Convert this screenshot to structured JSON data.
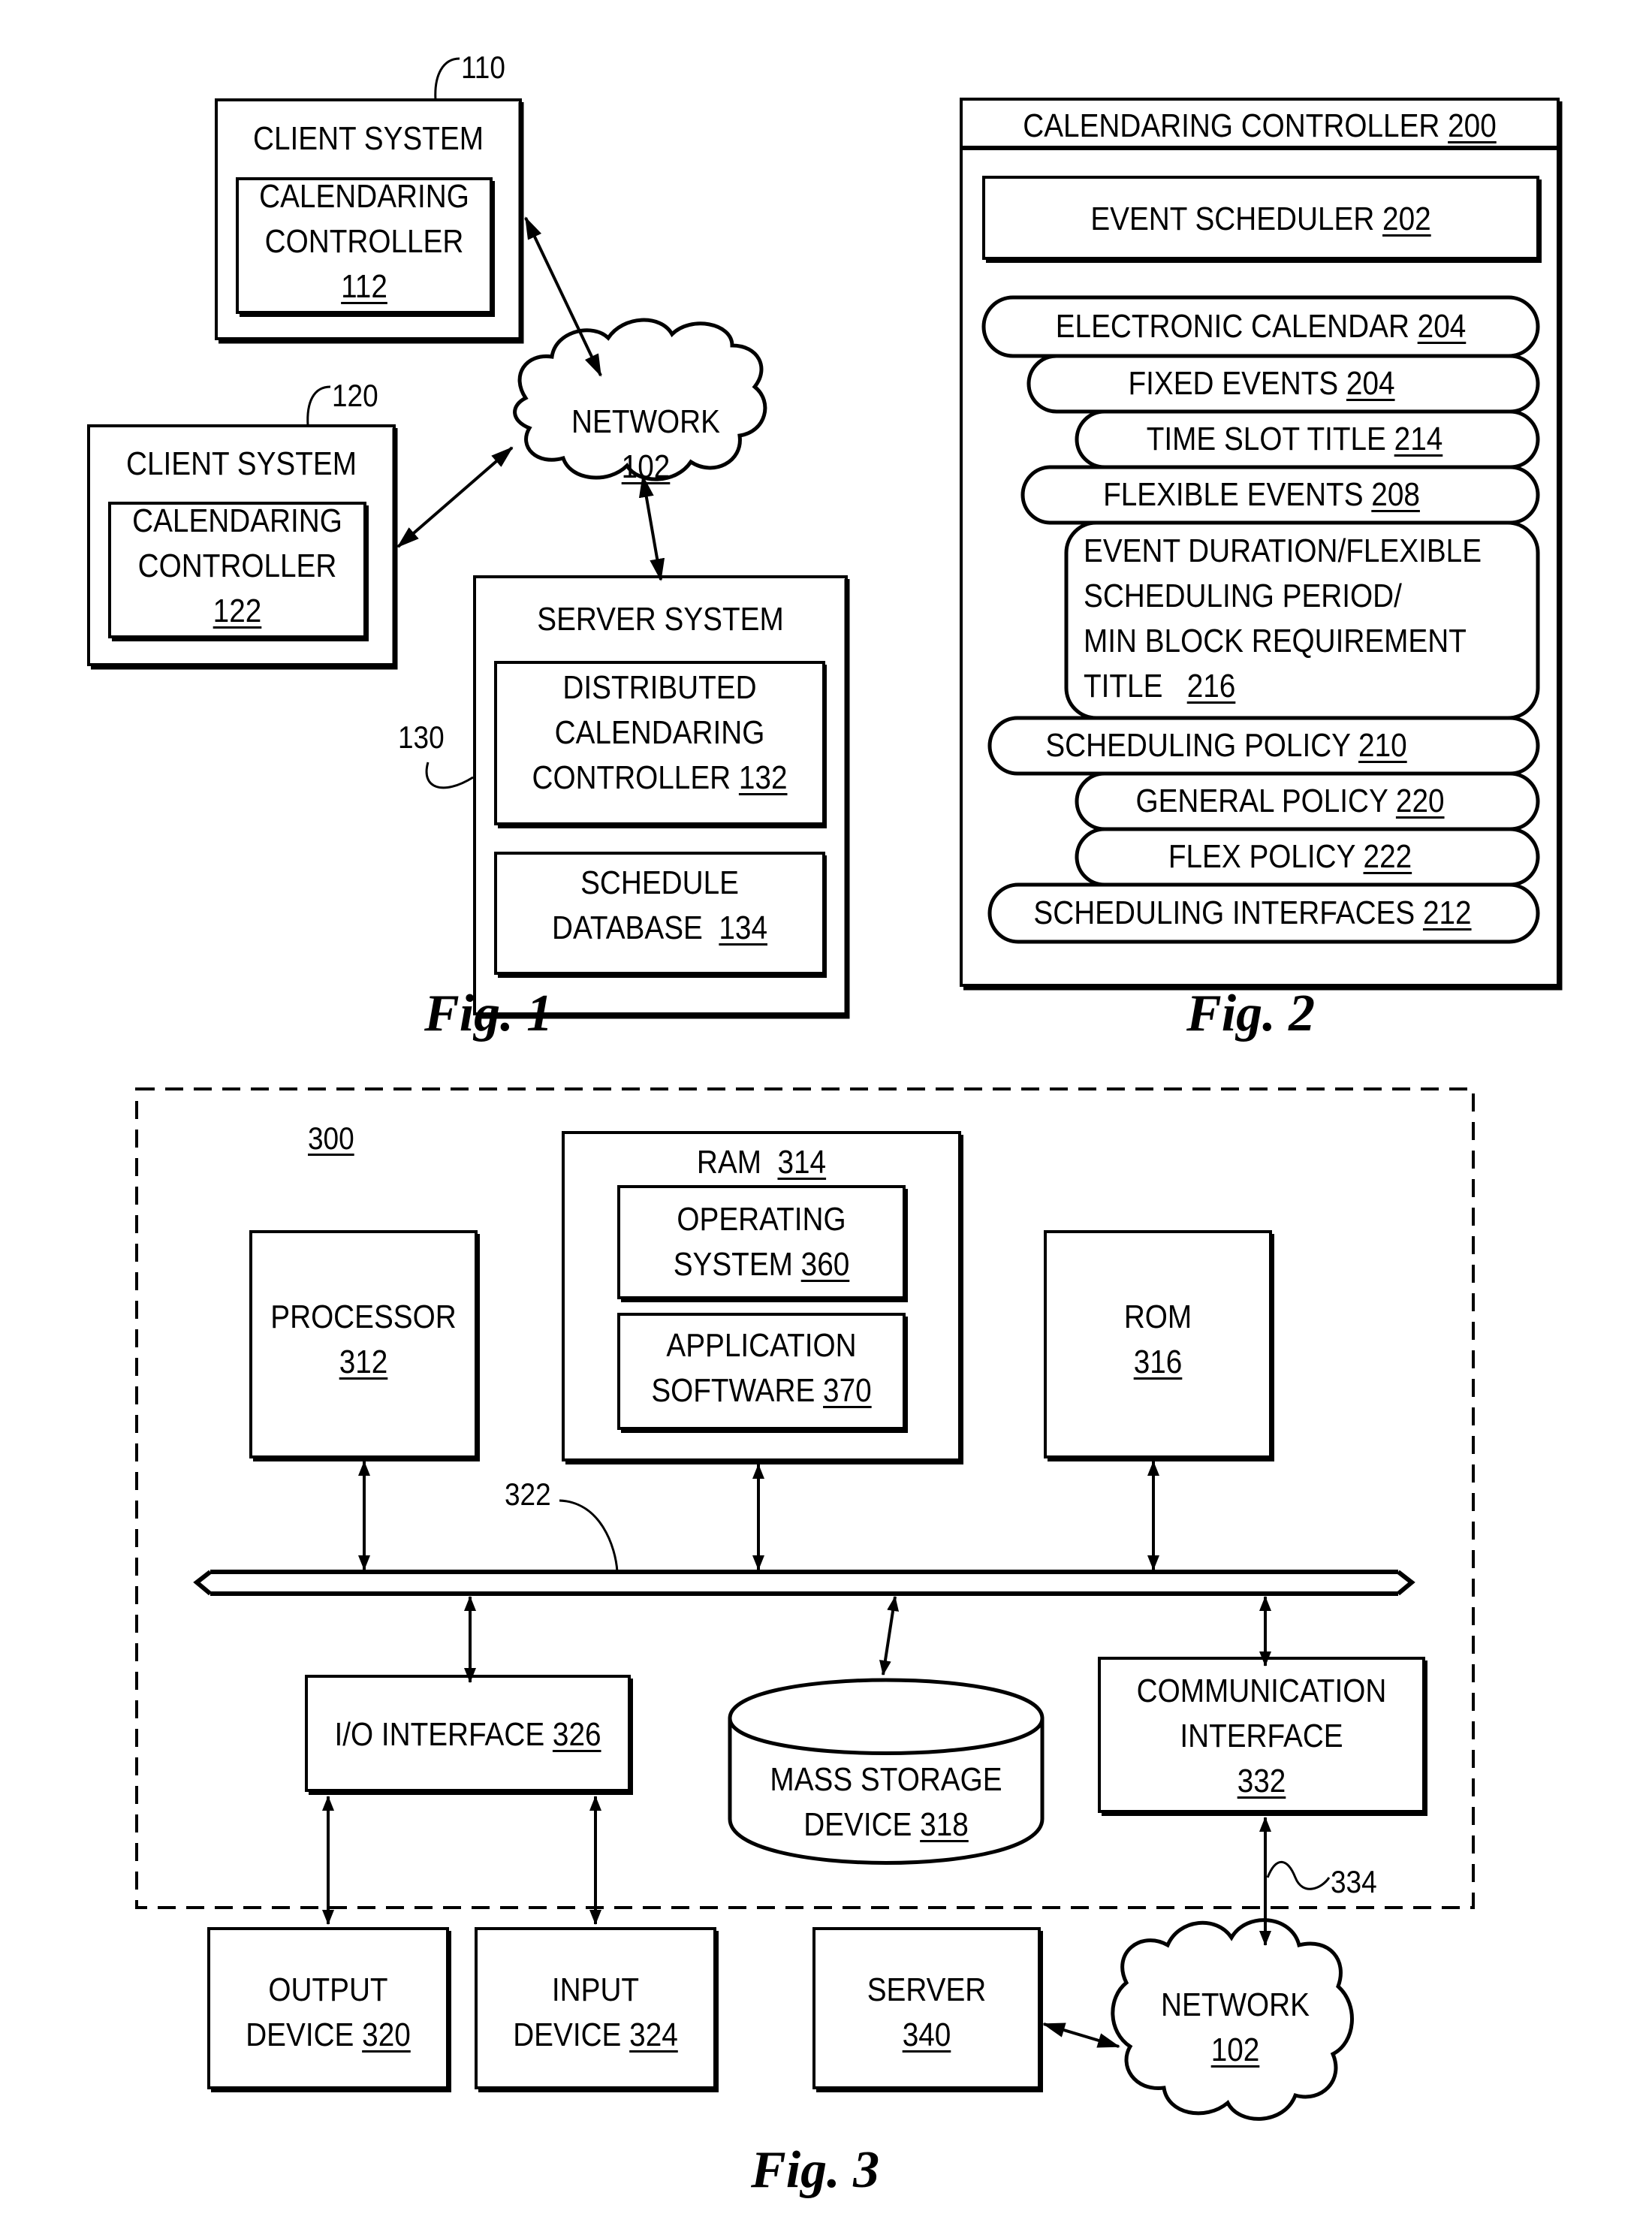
{
  "fig1": {
    "caption": "Fig. 1",
    "client_system_1": {
      "ref": "110",
      "title": "CLIENT SYSTEM",
      "controller_line1": "CALENDARING",
      "controller_line2": "CONTROLLER",
      "controller_num": "112"
    },
    "client_system_2": {
      "ref": "120",
      "title": "CLIENT SYSTEM",
      "controller_line1": "CALENDARING",
      "controller_line2": "CONTROLLER",
      "controller_num": "122"
    },
    "network": {
      "label": "NETWORK",
      "num": "102"
    },
    "server_system": {
      "ref": "130",
      "title": "SERVER SYSTEM",
      "distributed_line1": "DISTRIBUTED",
      "distributed_line2": "CALENDARING",
      "distributed_line3": "CONTROLLER",
      "distributed_num": "132",
      "database_line1": "SCHEDULE",
      "database_line2": "DATABASE",
      "database_num": "134"
    }
  },
  "fig2": {
    "caption": "Fig. 2",
    "title": "CALENDARING CONTROLLER",
    "title_num": "200",
    "event_scheduler": {
      "label": "EVENT SCHEDULER",
      "num": "202"
    },
    "items": [
      {
        "label": "ELECTRONIC CALENDAR",
        "num": "204"
      },
      {
        "label": "FIXED EVENTS",
        "num": "204"
      },
      {
        "label": "TIME SLOT  TITLE",
        "num": "214"
      },
      {
        "label": "FLEXIBLE EVENTS",
        "num": "208"
      },
      {
        "label": "SCHEDULING POLICY",
        "num": "210"
      },
      {
        "label": "GENERAL POLICY",
        "num": "220"
      },
      {
        "label": "FLEX POLICY",
        "num": "222"
      },
      {
        "label": "SCHEDULING INTERFACES",
        "num": "212"
      }
    ],
    "duration_block": {
      "line1": "EVENT DURATION/FLEXIBLE",
      "line2": "SCHEDULING PERIOD/",
      "line3": "MIN BLOCK REQUIREMENT",
      "line4": "TITLE",
      "num": "216"
    }
  },
  "fig3": {
    "caption": "Fig. 3",
    "system_ref": "300",
    "bus_ref": "322",
    "link_ref": "334",
    "processor": {
      "label": "PROCESSOR",
      "num": "312"
    },
    "ram": {
      "label": "RAM",
      "num": "314"
    },
    "os": {
      "line1": "OPERATING",
      "line2": "SYSTEM",
      "num": "360"
    },
    "app": {
      "line1": "APPLICATION",
      "line2": "SOFTWARE",
      "num": "370"
    },
    "rom": {
      "label": "ROM",
      "num": "316"
    },
    "io": {
      "label": "I/O INTERFACE",
      "num": "326"
    },
    "mass_storage": {
      "line1": "MASS STORAGE",
      "line2": "DEVICE",
      "num": "318"
    },
    "comm": {
      "line1": "COMMUNICATION",
      "line2": "INTERFACE",
      "num": "332"
    },
    "output": {
      "line1": "OUTPUT",
      "line2": "DEVICE",
      "num": "320"
    },
    "input": {
      "line1": "INPUT",
      "line2": "DEVICE",
      "num": "324"
    },
    "server": {
      "line1": "SERVER",
      "num": "340"
    },
    "network": {
      "label": "NETWORK",
      "num": "102"
    }
  }
}
